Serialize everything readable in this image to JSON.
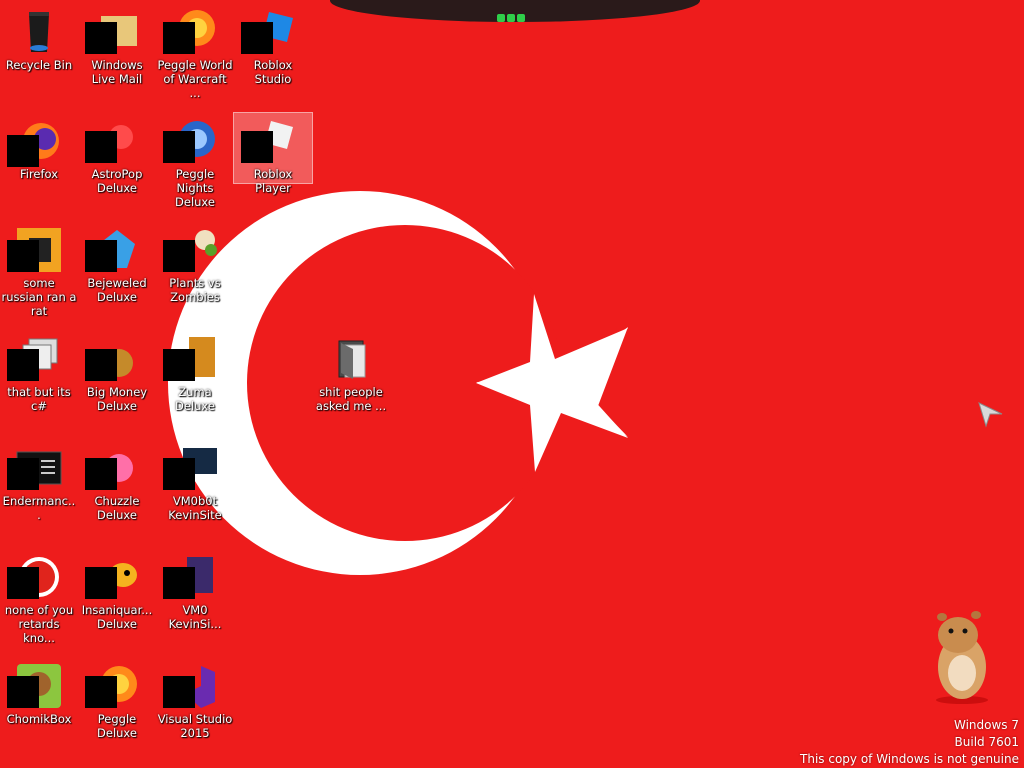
{
  "desktop": {
    "icons": [
      {
        "label": "Recycle Bin"
      },
      {
        "label": "Windows Live Mail"
      },
      {
        "label": "Peggle World of Warcraft ..."
      },
      {
        "label": "Roblox Studio"
      },
      {
        "label": "Firefox"
      },
      {
        "label": "AstroPop Deluxe"
      },
      {
        "label": "Peggle Nights Deluxe"
      },
      {
        "label": "Roblox Player"
      },
      {
        "label": "some russian ran a rat"
      },
      {
        "label": "Bejeweled Deluxe"
      },
      {
        "label": "Plants vs Zombies"
      },
      {
        "label": "that but its c#"
      },
      {
        "label": "Big Money Deluxe"
      },
      {
        "label": "Zuma Deluxe"
      },
      {
        "label": "Endermanc..."
      },
      {
        "label": "Chuzzle Deluxe"
      },
      {
        "label": "VM0b0t KevinSite"
      },
      {
        "label": "none of you retards kno..."
      },
      {
        "label": "Insaniquar... Deluxe"
      },
      {
        "label": "VM0 KevinSi..."
      },
      {
        "label": "ChomikBox"
      },
      {
        "label": "Peggle Deluxe"
      },
      {
        "label": "Visual Studio 2015"
      },
      {
        "label": "shit people asked me ..."
      }
    ]
  },
  "watermark": {
    "line1": "Windows 7",
    "line2": "Build 7601",
    "line3": "This copy of Windows is not genuine"
  },
  "colors": {
    "wallpaper_red": "#ee1c1c",
    "flag_white": "#ffffff"
  }
}
